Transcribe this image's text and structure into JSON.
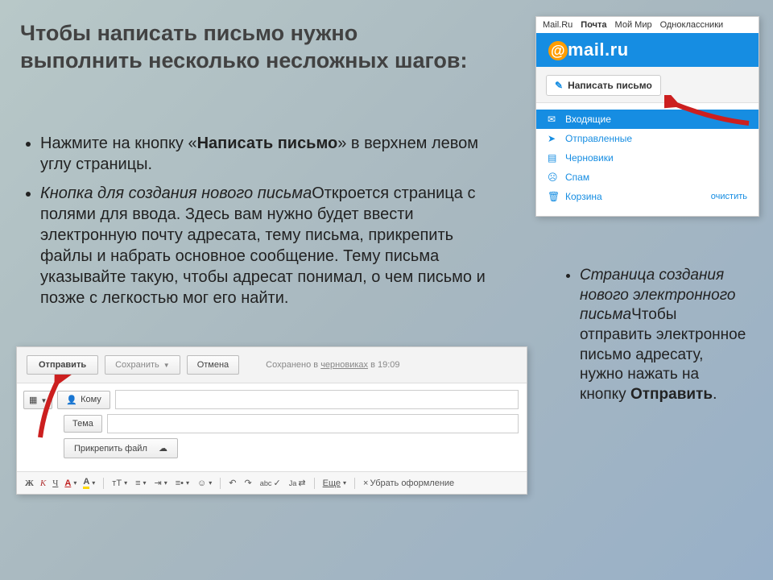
{
  "title": "Чтобы написать письмо нужно выполнить несколько несложных шагов:",
  "bullet1": {
    "pre": "Нажмите на кнопку «",
    "bold": "Написать письмо",
    "post": "» в верхнем левом углу страницы."
  },
  "bullet2": {
    "italic": "Кнопка для создания нового письма",
    "rest": "Откроется страница с полями для ввода. Здесь вам нужно будет ввести электронную почту адресата, тему письма, прикрепить файлы и набрать основное сообщение. Тему письма указывайте такую, чтобы адресат понимал, о чем письмо и позже с легкостью мог его найти."
  },
  "right_bullet": {
    "italic": "Страница создания нового электронного письма",
    "rest": "Чтобы отправить электронное письмо адресату, нужно нажать на кнопку ",
    "bold": "Отправить",
    "tail": "."
  },
  "mailru": {
    "topnav": {
      "a": "Mail.Ru",
      "b": "Почта",
      "c": "Мой Мир",
      "d": "Одноклассники"
    },
    "logo_text": "mail.ru",
    "compose": "Написать письмо",
    "folders": {
      "inbox": "Входящие",
      "sent": "Отправленные",
      "drafts": "Черновики",
      "spam": "Спам",
      "trash": "Корзина",
      "clear": "очистить"
    }
  },
  "compose": {
    "send": "Отправить",
    "save": "Сохранить",
    "cancel": "Отмена",
    "saved_pre": "Сохранено в ",
    "saved_link": "черновиках",
    "saved_post": " в 19:09",
    "to": "Кому",
    "subject": "Тема",
    "attach": "Прикрепить файл",
    "more": "Еще",
    "clearfmt": "Убрать оформление",
    "tt": "тТ"
  }
}
